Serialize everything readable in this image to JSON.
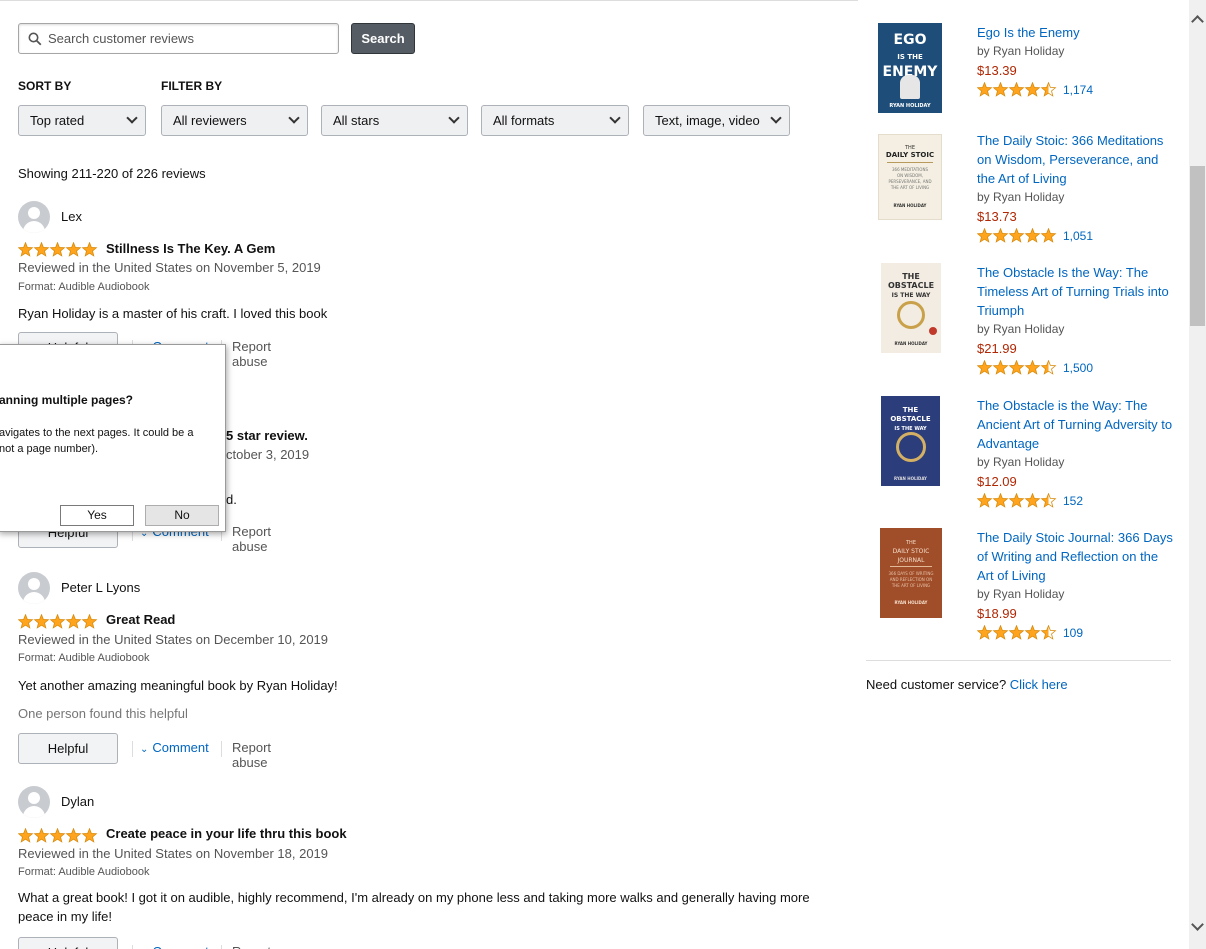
{
  "search": {
    "placeholder": "Search customer reviews",
    "button": "Search"
  },
  "sort": {
    "label": "SORT BY",
    "value": "Top rated"
  },
  "filter": {
    "label": "FILTER BY",
    "reviewers": "All reviewers",
    "stars": "All stars",
    "formats": "All formats",
    "media": "Text, image, video"
  },
  "showing": "Showing 211-220 of 226 reviews",
  "reviews": [
    {
      "name": "Lex",
      "rating": 5,
      "title": "Stillness Is The Key. A Gem",
      "date": "Reviewed in the United States on November 5, 2019",
      "format": "Format: Audible Audiobook",
      "body": "Ryan Holiday is a master of his craft. I loved this book"
    },
    {
      "title_partial": "5 star review.",
      "date_partial": "ctober 3, 2019",
      "body_partial": "d."
    },
    {
      "name": "Peter L Lyons",
      "rating": 5,
      "title": "Great Read",
      "date": "Reviewed in the United States on December 10, 2019",
      "format": "Format: Audible Audiobook",
      "body": "Yet another amazing meaningful book by Ryan Holiday!",
      "helpful_note": "One person found this helpful"
    },
    {
      "name": "Dylan",
      "rating": 5,
      "title": "Create peace in your life thru this book",
      "date": "Reviewed in the United States on November 18, 2019",
      "format": "Format: Audible Audiobook",
      "body": "What a great book! I got it on audible, highly recommend, I'm already on my phone less and taking more walks and generally having more peace in my life!"
    }
  ],
  "actions": {
    "helpful": "Helpful",
    "comment": "Comment",
    "report": "Report abuse"
  },
  "dialog": {
    "title": "anning multiple pages?",
    "text_line1": "avigates to the next pages. It could be a",
    "text_line2": "not a page number).",
    "yes": "Yes",
    "no": "No"
  },
  "sidebar": {
    "books": [
      {
        "title": "Ego Is the Enemy",
        "author": "by  Ryan Holiday",
        "price": "$13.39",
        "rating": 4.5,
        "count": "1,174",
        "cover_text": "EGO IS THE ENEMY",
        "cover_author": "RYAN HOLIDAY",
        "cover_color": "#1f4f7a"
      },
      {
        "title": "The Daily Stoic: 366 Meditations on Wisdom, Perseverance, and the Art of Living",
        "author": "by  Ryan Holiday",
        "price": "$13.73",
        "rating": 5,
        "count": "1,051",
        "cover_text": "THE DAILY STOIC",
        "cover_author": "RYAN HOLIDAY",
        "cover_color": "#f4efe2"
      },
      {
        "title": "The Obstacle Is the Way: The Timeless Art of Turning Trials into Triumph",
        "author": "by  Ryan Holiday",
        "price": "$21.99",
        "rating": 4.5,
        "count": "1,500",
        "cover_text": "THE OBSTACLE IS THE WAY",
        "cover_author": "RYAN HOLIDAY",
        "cover_color": "#f3ece2"
      },
      {
        "title": "The Obstacle is the Way: The Ancient Art of Turning Adversity to Advantage",
        "author": "by  Ryan Holiday",
        "price": "$12.09",
        "rating": 4.5,
        "count": "152",
        "cover_text": "THE OBSTACLE IS THE WAY",
        "cover_author": "RYAN HOLIDAY",
        "cover_color": "#2d3e7d"
      },
      {
        "title": "The Daily Stoic Journal: 366 Days of Writing and Reflection on the Art of Living",
        "author": "by  Ryan Holiday",
        "price": "$18.99",
        "rating": 4.5,
        "count": "109",
        "cover_text": "THE DAILY STOIC JOURNAL",
        "cover_author": "RYAN HOLIDAY",
        "cover_color": "#a34e2a"
      }
    ],
    "customer_service": "Need customer service?",
    "click_here": "Click here"
  },
  "colors": {
    "star": "#ffa41c",
    "link": "#0066c0",
    "price": "#b12704"
  }
}
